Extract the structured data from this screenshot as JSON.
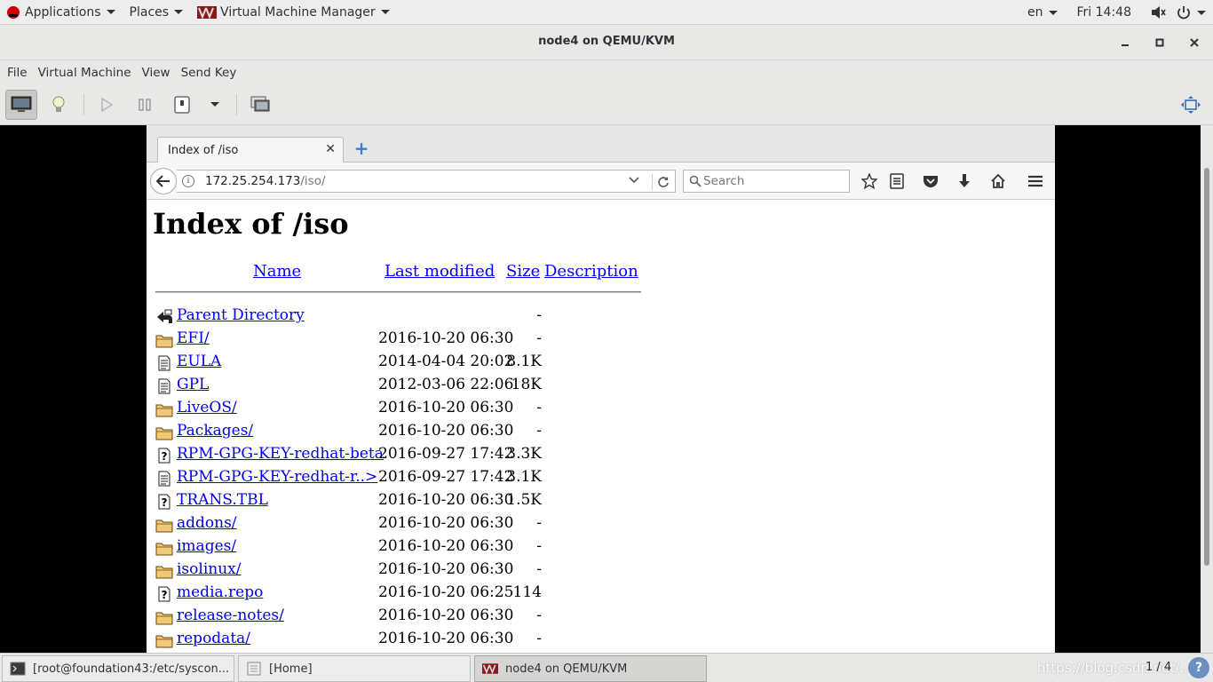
{
  "topbar": {
    "applications": "Applications",
    "places": "Places",
    "app_name": "Virtual Machine Manager",
    "lang": "en",
    "clock": "Fri 14:48"
  },
  "window": {
    "title": "node4 on QEMU/KVM",
    "menu": [
      "File",
      "Virtual Machine",
      "View",
      "Send Key"
    ]
  },
  "browser": {
    "tab_title": "Index of /iso",
    "url_host": "172.25.254.173",
    "url_path": "/iso/",
    "search_placeholder": "Search"
  },
  "listing": {
    "heading": "Index of /iso",
    "columns": {
      "name": "Name",
      "modified": "Last modified",
      "size": "Size",
      "description": "Description"
    },
    "rows": [
      {
        "icon": "back",
        "name": "Parent Directory",
        "modified": "",
        "size": "-"
      },
      {
        "icon": "folder",
        "name": "EFI/",
        "modified": "2016-10-20 06:30",
        "size": "-"
      },
      {
        "icon": "text",
        "name": "EULA",
        "modified": "2014-04-04 20:02",
        "size": "8.1K"
      },
      {
        "icon": "text",
        "name": "GPL",
        "modified": "2012-03-06 22:06",
        "size": "18K"
      },
      {
        "icon": "folder",
        "name": "LiveOS/",
        "modified": "2016-10-20 06:30",
        "size": "-"
      },
      {
        "icon": "folder",
        "name": "Packages/",
        "modified": "2016-10-20 06:30",
        "size": "-"
      },
      {
        "icon": "unknown",
        "name": "RPM-GPG-KEY-redhat-beta",
        "modified": "2016-09-27 17:42",
        "size": "3.3K"
      },
      {
        "icon": "text",
        "name": "RPM-GPG-KEY-redhat-r..>",
        "modified": "2016-09-27 17:42",
        "size": "3.1K"
      },
      {
        "icon": "unknown",
        "name": "TRANS.TBL",
        "modified": "2016-10-20 06:30",
        "size": "1.5K"
      },
      {
        "icon": "folder",
        "name": "addons/",
        "modified": "2016-10-20 06:30",
        "size": "-"
      },
      {
        "icon": "folder",
        "name": "images/",
        "modified": "2016-10-20 06:30",
        "size": "-"
      },
      {
        "icon": "folder",
        "name": "isolinux/",
        "modified": "2016-10-20 06:30",
        "size": "-"
      },
      {
        "icon": "unknown",
        "name": "media.repo",
        "modified": "2016-10-20 06:25",
        "size": "114"
      },
      {
        "icon": "folder",
        "name": "release-notes/",
        "modified": "2016-10-20 06:30",
        "size": "-"
      },
      {
        "icon": "folder",
        "name": "repodata/",
        "modified": "2016-10-20 06:30",
        "size": "-"
      }
    ]
  },
  "taskbar": {
    "tasks": [
      "[root@foundation43:/etc/syscon...",
      "[Home]",
      "node4 on QEMU/KVM"
    ],
    "watermark": "https://blog.csdn.net/...",
    "pager": "1 / 4",
    "help": "?"
  }
}
